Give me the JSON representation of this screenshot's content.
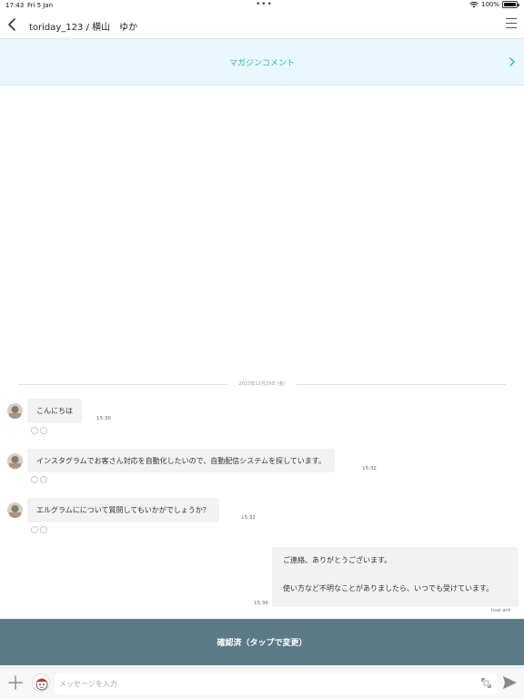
{
  "status_bar": {
    "time": "17:43",
    "date": "Fri 5 Jan",
    "dots": "•••",
    "battery": "100%"
  },
  "header": {
    "title": "toriday_123 / 横山　ゆか"
  },
  "magazine": {
    "label": "マガジンコメント"
  },
  "divider": {
    "date": "2023年12月29日 (金)"
  },
  "messages": [
    {
      "text": "こんにちは",
      "time": "15:30"
    },
    {
      "text": "インスタグラムでお客さん対応を自動化したいので、自動配信システムを探しています。",
      "time": "15:32"
    },
    {
      "text": "エルグラムにについて質問してもいかがでしょうか？",
      "time": "15:32"
    }
  ],
  "reply": {
    "line1": "ご連絡、ありがとうございます。",
    "line2": "使い方など不明なことがありましたら、いつでも受けています。",
    "time": "15:36",
    "sender": "hoai anh"
  },
  "banner": {
    "label": "確認済（タップで変更）"
  },
  "composer": {
    "placeholder": "メッセージを入力"
  },
  "colors": {
    "accent": "#2bb1cf",
    "banner": "#5b7a88",
    "magazine_bg": "#e9f8fc"
  },
  "icons": [
    "back-chevron-icon",
    "hamburger-menu-icon",
    "chevron-right-icon",
    "plus-icon",
    "stamp-icon",
    "expand-icon",
    "send-icon",
    "wifi-icon",
    "battery-icon"
  ]
}
